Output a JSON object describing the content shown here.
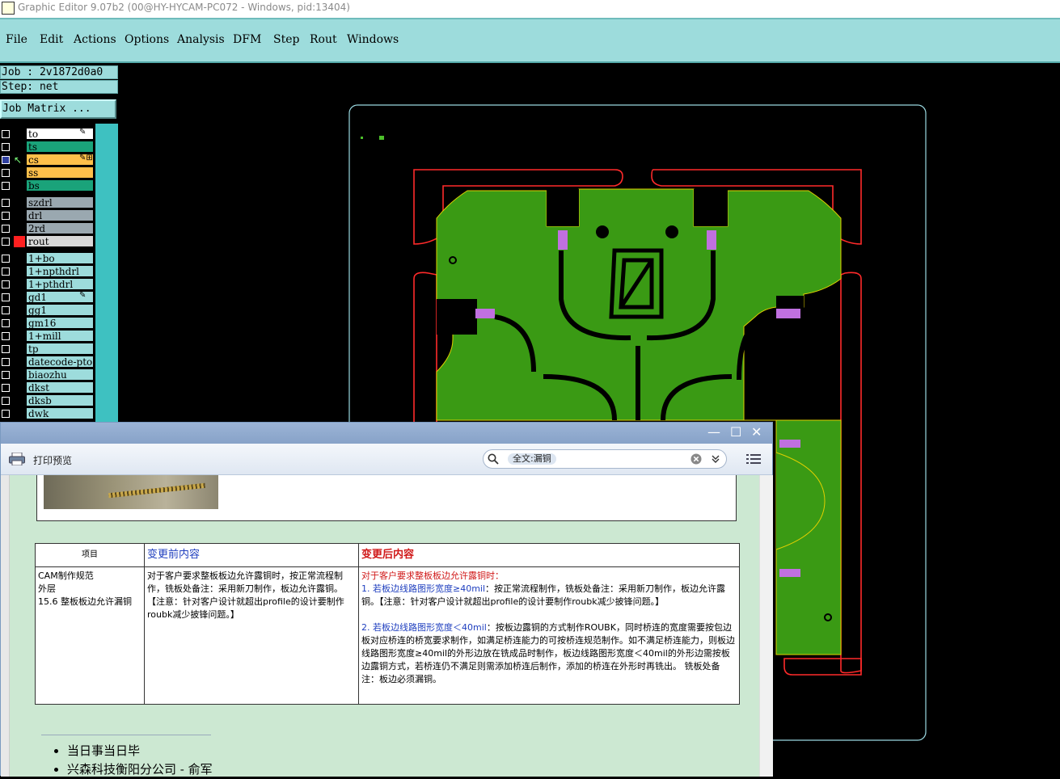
{
  "window": {
    "title": "Graphic Editor 9.07b2 (00@HY-HYCAM-PC072 - Windows, pid:13404)"
  },
  "menu": [
    "File",
    "Edit",
    "Actions",
    "Options",
    "Analysis",
    "DFM",
    "Step",
    "Rout",
    "Windows"
  ],
  "job": {
    "job_line": "Job : 2v1872d0a0",
    "step_line": "Step: net",
    "matrix_button": "Job Matrix ..."
  },
  "layers": [
    {
      "name": "to",
      "color": "#ffffff",
      "flag": "✎"
    },
    {
      "name": "ts",
      "color": "#1aa37a",
      "flag": ""
    },
    {
      "name": "cs",
      "color": "#ffc04a",
      "flag": "✎⊞",
      "selected": true
    },
    {
      "name": "ss",
      "color": "#ffc04a",
      "flag": ""
    },
    {
      "name": "bs",
      "color": "#1aa37a",
      "flag": ""
    },
    {
      "name": "szdrl",
      "color": "#9aa8b0",
      "flag": ""
    },
    {
      "name": "drl",
      "color": "#9aa8b0",
      "flag": ""
    },
    {
      "name": "2rd",
      "color": "#9aa8b0",
      "flag": ""
    },
    {
      "name": "rout",
      "color": "#d8d8d8",
      "flag": "",
      "swatch": "red"
    },
    {
      "name": "1+bo",
      "color": "#9ddcdc",
      "flag": ""
    },
    {
      "name": "1+npthdrl",
      "color": "#9ddcdc",
      "flag": ""
    },
    {
      "name": "1+pthdrl",
      "color": "#9ddcdc",
      "flag": ""
    },
    {
      "name": "gd1",
      "color": "#9ddcdc",
      "flag": "✎"
    },
    {
      "name": "gg1",
      "color": "#9ddcdc",
      "flag": ""
    },
    {
      "name": "gm16",
      "color": "#9ddcdc",
      "flag": ""
    },
    {
      "name": "1+mill",
      "color": "#9ddcdc",
      "flag": ""
    },
    {
      "name": "tp",
      "color": "#9ddcdc",
      "flag": ""
    },
    {
      "name": "datecode-pto",
      "color": "#9ddcdc",
      "flag": ""
    },
    {
      "name": "biaozhu",
      "color": "#9ddcdc",
      "flag": ""
    },
    {
      "name": "dkst",
      "color": "#9ddcdc",
      "flag": ""
    },
    {
      "name": "dksb",
      "color": "#9ddcdc",
      "flag": ""
    },
    {
      "name": "dwk",
      "color": "#9ddcdc",
      "flag": ""
    }
  ],
  "dialog": {
    "toolbar_label": "打印预览",
    "search_value": "全文:漏铜",
    "table": {
      "headers": [
        "项目",
        "变更前内容",
        "变更后内容"
      ],
      "item": [
        "CAM制作规范",
        "外层",
        "15.6 整板板边允许漏铜"
      ],
      "before": "对于客户要求整板板边允许露铜时，按正常流程制作，铣板处备注：采用新刀制作，板边允许露铜。【注意：针对客户设计就超出profile的设计要制作roubk减少披锋问题。】",
      "after_intro": "对于客户要求整板板边允许露铜时：",
      "after_p1_lead": "1. 若板边线路图形宽度≥40mil",
      "after_p1": "：按正常流程制作，铣板处备注：采用新刀制作，板边允许露铜。【注意：针对客户设计就超出profile的设计要制作roubk减少披锋问题。】",
      "after_p2_lead": "2. 若板边线路图形宽度＜40mil",
      "after_p2": "：按板边露铜的方式制作ROUBK，同时桥连的宽度需要按包边板对应桥连的桥宽要求制作，如满足桥连能力的可按桥连规范制作。如不满足桥连能力，则板边线路图形宽度≥40mil的外形边放在铣成品时制作，板边线路图形宽度＜40mil的外形边需按板边露铜方式，若桥连仍不满足则需添加桥连后制作，添加的桥连在外形时再铣出。 铣板处备注：板边必须漏铜。"
    },
    "bullets": [
      "当日事当日毕",
      "兴森科技衡阳分公司 - 俞军"
    ]
  }
}
